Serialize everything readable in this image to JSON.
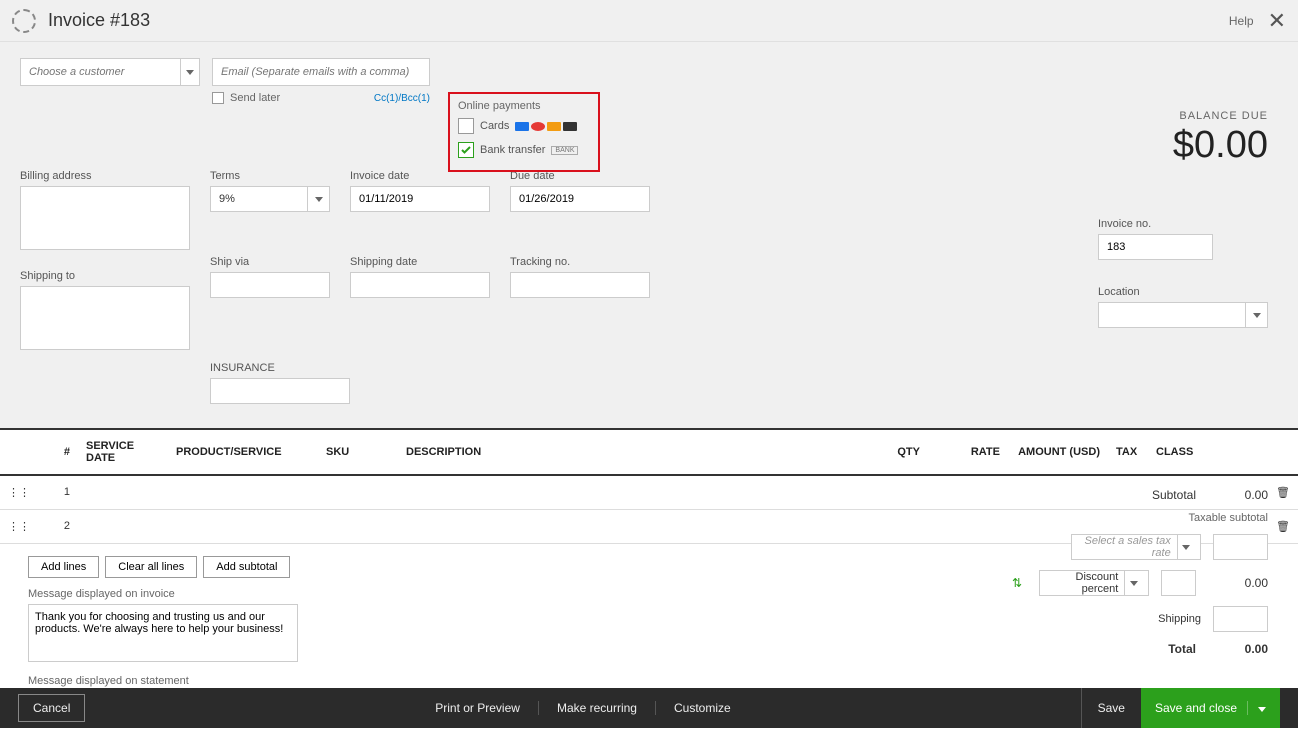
{
  "header": {
    "title": "Invoice #183",
    "help_label": "Help"
  },
  "customer": {
    "placeholder": "Choose a customer",
    "email_placeholder": "Email (Separate emails with a comma)",
    "send_later_label": "Send later",
    "cc_bcc": "Cc(1)/Bcc(1)"
  },
  "online_payments": {
    "title": "Online payments",
    "cards_label": "Cards",
    "cards_checked": false,
    "bank_label": "Bank transfer",
    "bank_checked": true,
    "bank_badge": "BANK"
  },
  "balance": {
    "label": "BALANCE DUE",
    "amount": "$0.00"
  },
  "fields": {
    "billing_address": "Billing address",
    "shipping_to": "Shipping to",
    "terms_label": "Terms",
    "terms_value": "9%",
    "invoice_date_label": "Invoice date",
    "invoice_date_value": "01/11/2019",
    "due_date_label": "Due date",
    "due_date_value": "01/26/2019",
    "ship_via_label": "Ship via",
    "shipping_date_label": "Shipping date",
    "tracking_no_label": "Tracking no.",
    "insurance_label": "INSURANCE",
    "invoice_no_label": "Invoice no.",
    "invoice_no_value": "183",
    "location_label": "Location"
  },
  "table": {
    "headers": {
      "num": "#",
      "service_date": "SERVICE DATE",
      "product": "PRODUCT/SERVICE",
      "sku": "SKU",
      "description": "DESCRIPTION",
      "qty": "QTY",
      "rate": "RATE",
      "amount": "AMOUNT (USD)",
      "tax": "TAX",
      "class": "CLASS"
    },
    "rows": [
      {
        "num": "1"
      },
      {
        "num": "2"
      }
    ]
  },
  "buttons": {
    "add_lines": "Add lines",
    "clear_all": "Clear all lines",
    "add_subtotal": "Add subtotal"
  },
  "messages": {
    "invoice_label": "Message displayed on invoice",
    "invoice_value": "Thank you for choosing and trusting us and our products. We're always here to help your business!",
    "statement_label": "Message displayed on statement"
  },
  "totals": {
    "subtotal_label": "Subtotal",
    "subtotal_value": "0.00",
    "taxable_label": "Taxable subtotal",
    "tax_placeholder": "Select a sales tax rate",
    "discount_label": "Discount percent",
    "discount_value": "0.00",
    "shipping_label": "Shipping",
    "total_label": "Total",
    "total_value": "0.00"
  },
  "footer": {
    "cancel": "Cancel",
    "print": "Print or Preview",
    "recurring": "Make recurring",
    "customize": "Customize",
    "save": "Save",
    "save_close": "Save and close"
  }
}
